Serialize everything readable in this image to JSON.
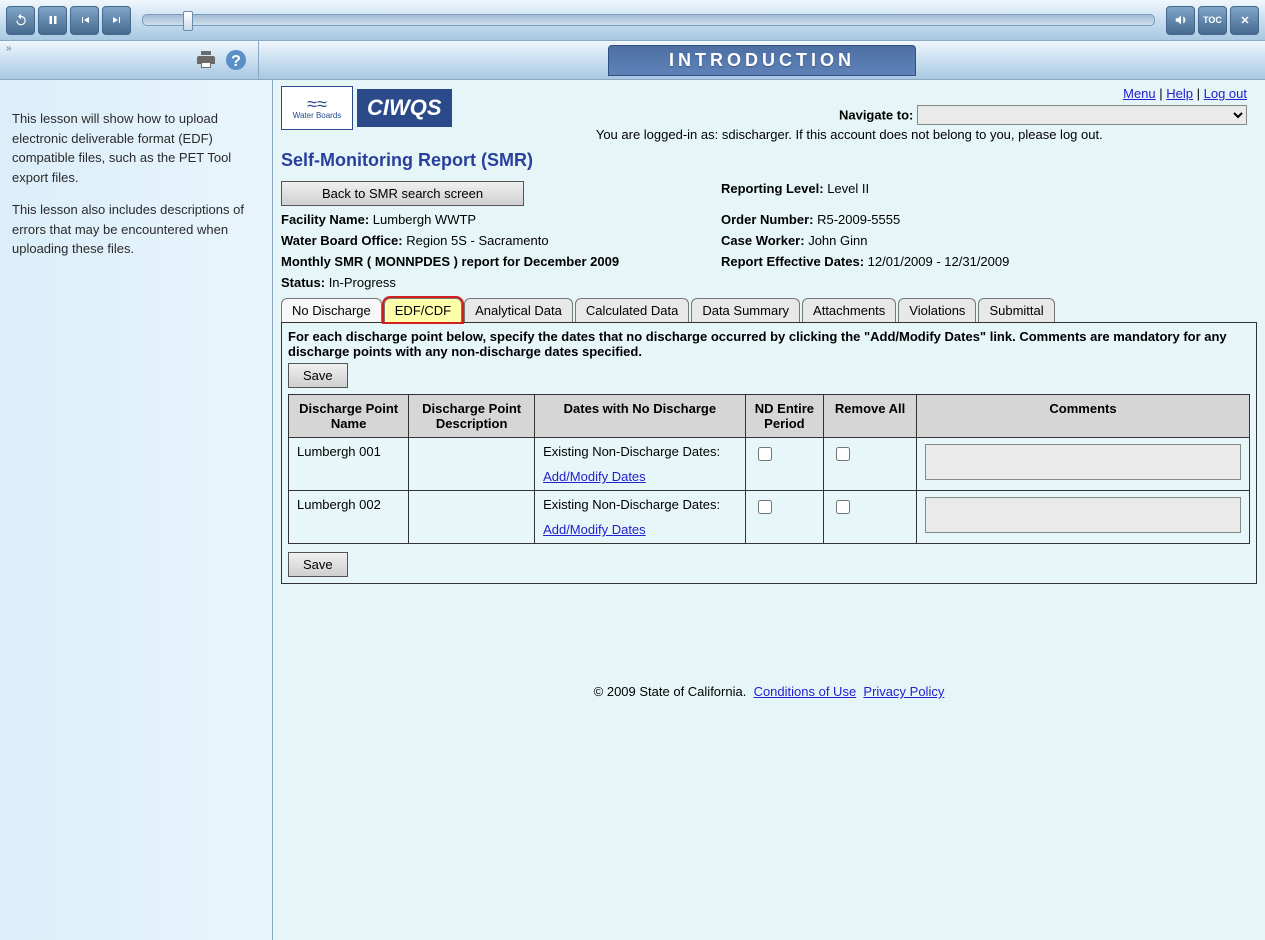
{
  "course": {
    "title": "INTRODUCTION",
    "sidebar_p1": "This lesson will show how to upload electronic deliverable format (EDF) compatible files, such as the PET Tool export files.",
    "sidebar_p2": "This lesson also includes descriptions of errors that may be encountered when uploading these files."
  },
  "app": {
    "brand_small": "Water Boards",
    "brand_big": "CIWQS",
    "links": {
      "menu": "Menu",
      "help": "Help",
      "logout": "Log out"
    },
    "navigate_label": "Navigate to:",
    "logged_in_msg": "You are logged-in as: sdischarger. If this account does not belong to you, please log out.",
    "page_title": "Self-Monitoring Report (SMR)",
    "back_btn": "Back to SMR search screen",
    "info": {
      "facility_label": "Facility Name:",
      "facility_value": "Lumbergh WWTP",
      "office_label": "Water Board Office:",
      "office_value": "Region 5S - Sacramento",
      "report_label": "Monthly SMR ( MONNPDES ) report for December 2009",
      "status_label": "Status:",
      "status_value": "In-Progress",
      "level_label": "Reporting Level:",
      "level_value": "Level II",
      "order_label": "Order Number:",
      "order_value": "R5-2009-5555",
      "caseworker_label": "Case Worker:",
      "caseworker_value": "John Ginn",
      "effective_label": "Report Effective Dates:",
      "effective_value": "12/01/2009 - 12/31/2009"
    },
    "tabs": [
      "No Discharge",
      "EDF/CDF",
      "Analytical Data",
      "Calculated Data",
      "Data Summary",
      "Attachments",
      "Violations",
      "Submittal"
    ],
    "active_tab_index": 0,
    "highlight_tab_index": 1,
    "panel": {
      "instruction": "For each discharge point below, specify the dates that no discharge occurred by clicking the \"Add/Modify Dates\" link. Comments are mandatory for any discharge points with any non-discharge dates specified.",
      "save_label": "Save",
      "headers": {
        "c1": "Discharge Point Name",
        "c2": "Discharge Point Description",
        "c3": "Dates with No Discharge",
        "c4": "ND Entire Period",
        "c5": "Remove All",
        "c6": "Comments"
      },
      "existing_label": "Existing Non-Discharge Dates:",
      "addmod_label": "Add/Modify Dates",
      "rows": [
        {
          "name": "Lumbergh 001",
          "desc": ""
        },
        {
          "name": "Lumbergh 002",
          "desc": ""
        }
      ]
    },
    "footer": {
      "copyright": "© 2009 State of California.",
      "cond": "Conditions of Use",
      "priv": "Privacy Policy"
    }
  }
}
